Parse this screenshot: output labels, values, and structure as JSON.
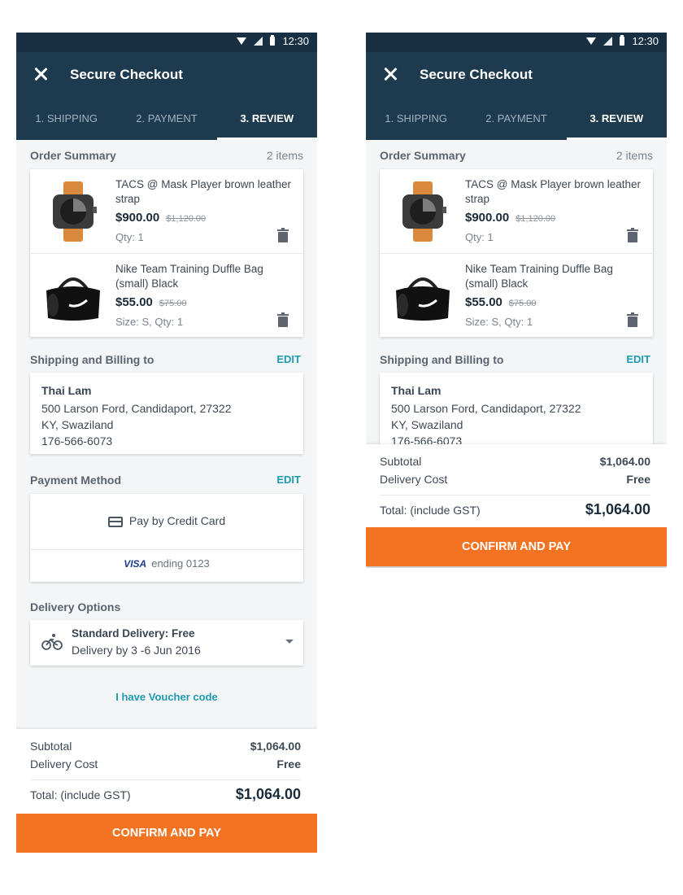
{
  "status": {
    "time": "12:30"
  },
  "appbar": {
    "title": "Secure Checkout"
  },
  "tabs": [
    {
      "label": "1. SHIPPING"
    },
    {
      "label": "2. PAYMENT"
    },
    {
      "label": "3. REVIEW"
    }
  ],
  "order": {
    "title": "Order Summary",
    "count": "2 items",
    "items": [
      {
        "name": "TACS @ Mask Player brown leather strap",
        "price": "$900.00",
        "old_price": "$1,120.00",
        "qty": "Qty: 1",
        "icon": "watch-image"
      },
      {
        "name": "Nike Team Training Duffle Bag (small) Black",
        "price": "$55.00",
        "old_price": "$75.00",
        "qty": "Size: S, Qty: 1",
        "icon": "duffle-bag-image"
      }
    ]
  },
  "shipping": {
    "title": "Shipping and Billing to",
    "edit": "EDIT",
    "name": "Thai Lam",
    "line1": "500 Larson Ford,  Candidaport,  27322",
    "line2": "KY, Swaziland",
    "phone": "176-566-6073"
  },
  "payment": {
    "title": "Payment Method",
    "edit": "EDIT",
    "method": "Pay by Credit Card",
    "brand": "VISA",
    "ending": "ending 0123"
  },
  "delivery": {
    "title": "Delivery Options",
    "option": "Standard Delivery:  Free",
    "date": "Delivery by 3 -6 Jun 2016"
  },
  "voucher": "I have Voucher code",
  "totals": {
    "subtotal_label": "Subtotal",
    "subtotal": "$1,064.00",
    "delivery_label": "Delivery Cost",
    "delivery": "Free",
    "total_label": "Total: (include GST)",
    "total": "$1,064.00"
  },
  "cta": "CONFIRM AND PAY",
  "colors": {
    "appbar": "#1e3a4e",
    "accent": "#1e9bb0",
    "cta": "#f47322"
  }
}
